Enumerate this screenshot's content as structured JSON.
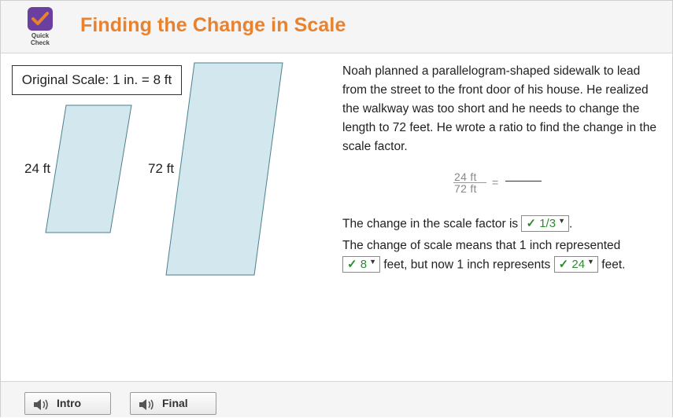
{
  "header": {
    "logo_line1": "Quick",
    "logo_line2": "Check",
    "title": "Finding the Change in Scale"
  },
  "figure": {
    "scale_label": "Original Scale: 1 in. = 8 ft",
    "small_label": "24 ft",
    "large_label": "72 ft",
    "fill_color": "#d2e8ee",
    "stroke_color": "#4d7f8f"
  },
  "passage": "Noah planned a parallelogram-shaped sidewalk to lead from the street to the front door of his house. He realized the walkway was too short and he needs to change the length to 72 feet. He wrote a ratio to find the change in the scale factor.",
  "ratio": {
    "numerator": "24 ft",
    "denominator": "72 ft",
    "equals": "="
  },
  "q1": {
    "text": "The change in the scale factor is",
    "answer": "1/3",
    "end": "."
  },
  "q2": {
    "line1": "The change of scale means that 1 inch represented",
    "answer1": "8",
    "mid": "feet, but now 1 inch represents",
    "answer2": "24",
    "end": "feet."
  },
  "dropdown_icons": {
    "check": "✓",
    "caret": "▼"
  },
  "footer": {
    "intro_label": "Intro",
    "final_label": "Final",
    "icon": "speaker-icon"
  }
}
